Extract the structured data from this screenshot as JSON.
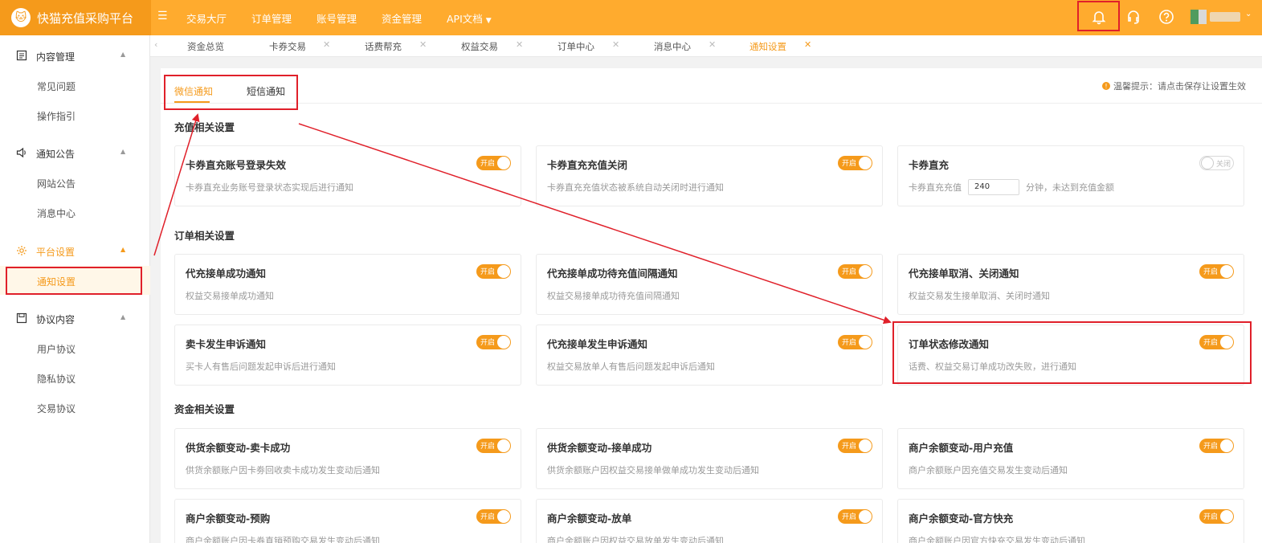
{
  "app": {
    "title": "快猫充值采购平台"
  },
  "topnav": [
    "交易大厅",
    "订单管理",
    "账号管理",
    "资金管理",
    "API文档"
  ],
  "sidebar": {
    "groups": [
      {
        "label": "内容管理",
        "items": [
          "常见问题",
          "操作指引"
        ]
      },
      {
        "label": "通知公告",
        "items": [
          "网站公告",
          "消息中心"
        ]
      },
      {
        "label": "平台设置",
        "items": [
          "通知设置"
        ]
      },
      {
        "label": "协议内容",
        "items": [
          "用户协议",
          "隐私协议",
          "交易协议"
        ]
      }
    ]
  },
  "tabs": [
    "资金总览",
    "卡券交易",
    "话费帮充",
    "权益交易",
    "订单中心",
    "消息中心",
    "通知设置"
  ],
  "subtabs": [
    "微信通知",
    "短信通知"
  ],
  "tip": "温馨提示：请点击保存让设置生效",
  "sections": [
    "充值相关设置",
    "订单相关设置",
    "资金相关设置"
  ],
  "toggle_on": "开启",
  "toggle_off": "关闭",
  "cards": [
    {
      "title": "卡券直充账号登录失效",
      "desc": "卡券直充业务账号登录状态实现后进行通知",
      "state": "开启"
    },
    {
      "title": "卡券直充充值关闭",
      "desc": "卡券直充充值状态被系统自动关闭时进行通知",
      "state": "开启"
    },
    {
      "title": "卡券直充",
      "desc_prefix": "卡券直充充值",
      "input_value": "240",
      "desc_suffix": "分钟，未达到充值金额",
      "state": "关闭"
    },
    {
      "title": "代充接单成功通知",
      "desc": "权益交易接单成功通知",
      "state": "开启"
    },
    {
      "title": "代充接单成功待充值间隔通知",
      "desc": "权益交易接单成功待充值间隔通知",
      "state": "开启"
    },
    {
      "title": "代充接单取消、关闭通知",
      "desc": "权益交易发生接单取消、关闭时通知",
      "state": "开启"
    },
    {
      "title": "卖卡发生申诉通知",
      "desc": "买卡人有售后问题发起申诉后进行通知",
      "state": "开启"
    },
    {
      "title": "代充接单发生申诉通知",
      "desc": "权益交易放单人有售后问题发起申诉后通知",
      "state": "开启"
    },
    {
      "title": "订单状态修改通知",
      "desc": "话费、权益交易订单成功改失败，进行通知",
      "state": "开启"
    },
    {
      "title": "供货余额变动-卖卡成功",
      "desc": "供货余额账户因卡劵回收卖卡成功发生变动后通知",
      "state": "开启"
    },
    {
      "title": "供货余额变动-接单成功",
      "desc": "供货余额账户因权益交易接单做单成功发生变动后通知",
      "state": "开启"
    },
    {
      "title": "商户余额变动-用户充值",
      "desc": "商户余额账户因充值交易发生变动后通知",
      "state": "开启"
    },
    {
      "title": "商户余额变动-预购",
      "desc": "商户余额账户因卡券直销预购交易发生变动后通知",
      "state": "开启"
    },
    {
      "title": "商户余额变动-放单",
      "desc": "商户余额账户因权益交易放单发生变动后通知",
      "state": "开启"
    },
    {
      "title": "商户余额变动-官方快充",
      "desc": "商户余额账户因官方快充交易发生变动后通知",
      "state": "开启"
    }
  ],
  "colors": {
    "accent": "#f59a1b",
    "topbar": "#ffab2e",
    "annotation": "#e0202a"
  }
}
